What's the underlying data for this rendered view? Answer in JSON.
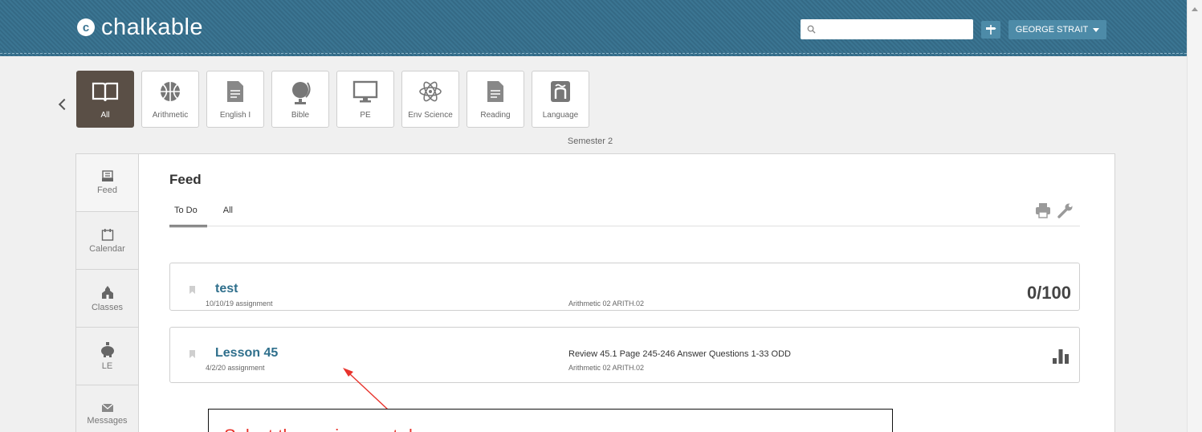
{
  "app": {
    "logo_mark": "c",
    "logo_text": "chalkable"
  },
  "header": {
    "search": {
      "value": "",
      "placeholder": ""
    },
    "user_name": "GEORGE STRAIT",
    "icons": {
      "search": "search-icon",
      "nav": "signpost-icon",
      "dropdown": "caret-down-icon"
    }
  },
  "classes": {
    "back_icon": "chevron-left-icon",
    "items": [
      {
        "label": "All",
        "icon": "open-book-icon",
        "active": true
      },
      {
        "label": "Arithmetic",
        "icon": "basketball-icon"
      },
      {
        "label": "English I",
        "icon": "document-icon"
      },
      {
        "label": "Bible",
        "icon": "globe-icon"
      },
      {
        "label": "PE",
        "icon": "monitor-icon"
      },
      {
        "label": "Env Science",
        "icon": "atom-icon"
      },
      {
        "label": "Reading",
        "icon": "document-icon"
      },
      {
        "label": "Language",
        "icon": "n-tilde-icon"
      }
    ],
    "semester": "Semester 2"
  },
  "sidenav": {
    "items": [
      {
        "label": "Feed",
        "icon": "inbox-icon",
        "active": true
      },
      {
        "label": "Calendar",
        "icon": "calendar-icon"
      },
      {
        "label": "Classes",
        "icon": "schoolhouse-icon"
      },
      {
        "label": "LE",
        "icon": "piggy-bank-icon"
      },
      {
        "label": "Messages",
        "icon": "envelope-icon"
      }
    ]
  },
  "feed": {
    "title": "Feed",
    "tabs": [
      {
        "label": "To Do",
        "active": true
      },
      {
        "label": "All"
      }
    ],
    "tools": {
      "print": "printer-icon",
      "settings": "wrench-icon"
    },
    "items": [
      {
        "title": "test",
        "meta": "10/10/19 assignment",
        "description": "",
        "class": "Arithmetic 02 ARITH.02",
        "score": "0/100"
      },
      {
        "title": "Lesson 45",
        "meta": "4/2/20 assignment",
        "description": "Review 45.1 Page 245-246 Answer Questions 1-33 ODD",
        "class": "Arithmetic 02 ARITH.02",
        "score": ""
      }
    ]
  },
  "annotation": {
    "text": "Select the assignment due",
    "color": "#e8332c"
  },
  "colors": {
    "header": "#3b7592",
    "link": "#2f6f8c",
    "active_tile": "#5a4f46"
  }
}
